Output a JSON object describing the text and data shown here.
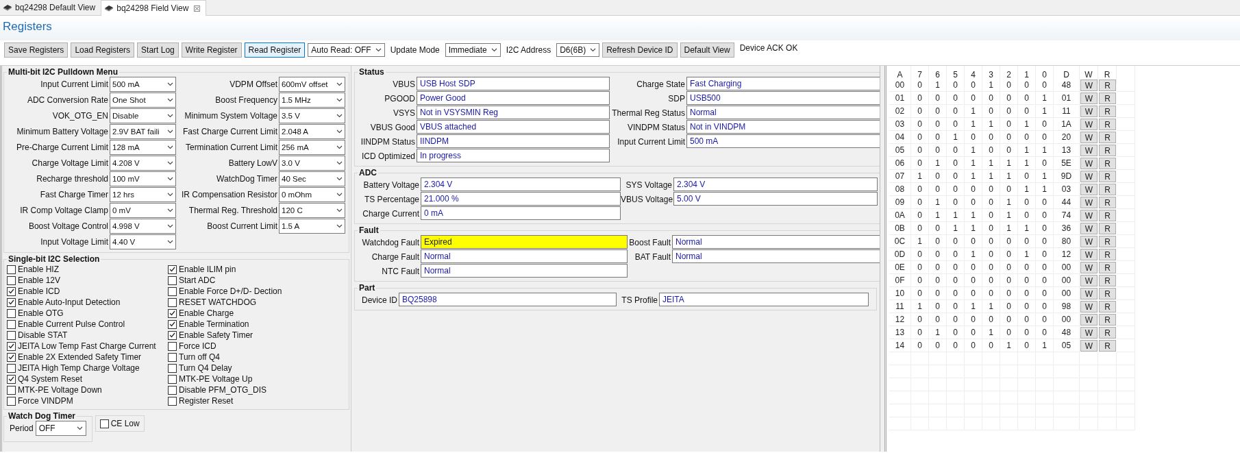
{
  "tabs": [
    {
      "label": "bq24298 Default View",
      "selected": false,
      "closable": false
    },
    {
      "label": "bq24298 Field View",
      "selected": true,
      "closable": true
    }
  ],
  "title": "Registers",
  "toolbar": [
    {
      "kind": "button",
      "label": "Save Registers",
      "focused": false
    },
    {
      "kind": "button",
      "label": "Load Registers",
      "focused": false
    },
    {
      "kind": "button",
      "label": "Start Log",
      "focused": false
    },
    {
      "kind": "button",
      "label": "Write Register",
      "focused": false
    },
    {
      "kind": "button",
      "label": "Read Register",
      "focused": true
    },
    {
      "kind": "dropdown",
      "label": "Auto Read: OFF"
    },
    {
      "kind": "label",
      "label": "Update Mode"
    },
    {
      "kind": "dropdown",
      "label": "Immediate"
    },
    {
      "kind": "label",
      "label": "I2C Address"
    },
    {
      "kind": "dropdown",
      "label": "D6(6B)"
    },
    {
      "kind": "button",
      "label": "Refresh Device ID",
      "focused": false
    },
    {
      "kind": "button",
      "label": "Default View",
      "focused": false
    },
    {
      "kind": "label",
      "label": "Device ACK OK"
    }
  ],
  "multibit": {
    "title": "Multi-bit I2C Pulldown Menu",
    "left": [
      {
        "label": "Input Current Limit",
        "value": "500 mA"
      },
      {
        "label": "ADC Conversion Rate",
        "value": "One Shot"
      },
      {
        "label": "VOK_OTG_EN",
        "value": "Disable"
      },
      {
        "label": "Minimum Battery Voltage",
        "value": "2.9V BAT faili"
      },
      {
        "label": "Pre-Charge Current Limit",
        "value": "128 mA"
      },
      {
        "label": "Charge Voltage Limit",
        "value": "4.208 V"
      },
      {
        "label": "Recharge threshold",
        "value": "100 mV"
      },
      {
        "label": "Fast Charge Timer",
        "value": "12 hrs"
      },
      {
        "label": "IR Comp Voltage Clamp",
        "value": "0 mV"
      },
      {
        "label": "Boost Voltage Control",
        "value": "4.998 V"
      },
      {
        "label": "Input Voltage Limit",
        "value": "4.40 V"
      }
    ],
    "right": [
      {
        "label": "VDPM Offset",
        "value": "600mV offset"
      },
      {
        "label": "Boost Frequency",
        "value": "1.5 MHz"
      },
      {
        "label": "Minimum System Voltage",
        "value": "3.5 V"
      },
      {
        "label": "Fast Charge Current Limit",
        "value": "2.048 A"
      },
      {
        "label": "Termination Current Limit",
        "value": "256 mA"
      },
      {
        "label": "Battery LowV",
        "value": "3.0 V"
      },
      {
        "label": "WatchDog Timer",
        "value": "40 Sec"
      },
      {
        "label": "IR Compensation Resistor",
        "value": "0 mOhm"
      },
      {
        "label": "Thermal Reg. Threshold",
        "value": "120 C"
      },
      {
        "label": "Boost Current Limit",
        "value": "1.5 A"
      }
    ]
  },
  "singlebit": {
    "title": "Single-bit I2C Selection",
    "left": [
      {
        "label": "Enable HIZ",
        "checked": false
      },
      {
        "label": "Enable 12V",
        "checked": false
      },
      {
        "label": "Enable ICD",
        "checked": true
      },
      {
        "label": "Enable Auto-Input Detection",
        "checked": true
      },
      {
        "label": "Enable OTG",
        "checked": false
      },
      {
        "label": "Enable Current Pulse Control",
        "checked": false
      },
      {
        "label": "Disable STAT",
        "checked": false
      },
      {
        "label": "JEITA Low Temp Fast Charge Current",
        "checked": true
      },
      {
        "label": "Enable 2X Extended Safety Timer",
        "checked": true
      },
      {
        "label": "JEITA High Temp Charge Voltage",
        "checked": false
      },
      {
        "label": "Q4 System Reset",
        "checked": true
      },
      {
        "label": "MTK-PE Voltage Down",
        "checked": false
      },
      {
        "label": "Force VINDPM",
        "checked": false
      }
    ],
    "right": [
      {
        "label": "Enable ILIM pin",
        "checked": true
      },
      {
        "label": "Start ADC",
        "checked": false
      },
      {
        "label": "Enable Force D+/D- Dection",
        "checked": false
      },
      {
        "label": "RESET WATCHDOG",
        "checked": false
      },
      {
        "label": "Enable Charge",
        "checked": true
      },
      {
        "label": "Enable Termination",
        "checked": true
      },
      {
        "label": "Enable Safety Timer",
        "checked": true
      },
      {
        "label": "Force ICD",
        "checked": false
      },
      {
        "label": "Turn off Q4",
        "checked": false
      },
      {
        "label": "Turn Q4 Delay",
        "checked": false
      },
      {
        "label": "MTK-PE Voltage Up",
        "checked": false
      },
      {
        "label": "Disable PFM_OTG_DIS",
        "checked": false
      },
      {
        "label": "Register Reset",
        "checked": false
      }
    ]
  },
  "watchdog": {
    "title": "Watch Dog Timer",
    "period_label": "Period",
    "period_value": "OFF"
  },
  "ce_low": {
    "label": "CE Low",
    "checked": false
  },
  "sections": [
    {
      "title": "Status",
      "left": [
        {
          "label": "VBUS",
          "value": "USB Host SDP",
          "alert": false
        },
        {
          "label": "PGOOD",
          "value": "Power Good",
          "alert": false
        },
        {
          "label": "VSYS",
          "value": "Not in VSYSMIN Reg",
          "alert": false
        },
        {
          "label": "VBUS Good",
          "value": "VBUS attached",
          "alert": false
        },
        {
          "label": "IINDPM Status",
          "value": "IINDPM",
          "alert": false
        },
        {
          "label": "ICD Optimized",
          "value": "In progress",
          "alert": false
        }
      ],
      "right": [
        {
          "label": "Charge State",
          "value": "Fast Charging",
          "alert": false
        },
        {
          "label": "SDP",
          "value": "USB500",
          "alert": false
        },
        {
          "label": "Thermal Reg Status",
          "value": "Normal",
          "alert": false
        },
        {
          "label": "VINDPM Status",
          "value": "Not in VINDPM",
          "alert": false
        },
        {
          "label": "Input Current Limit",
          "value": "500 mA",
          "alert": false
        }
      ]
    },
    {
      "title": "ADC",
      "left": [
        {
          "label": "Battery Voltage",
          "value": "2.304 V",
          "alert": false
        },
        {
          "label": "TS Percentage",
          "value": "21.000 %",
          "alert": false
        },
        {
          "label": "Charge Current",
          "value": "0 mA",
          "alert": false
        }
      ],
      "right": [
        {
          "label": "SYS Voltage",
          "value": "2.304 V",
          "alert": false
        },
        {
          "label": "VBUS Voltage",
          "value": "5.00 V",
          "alert": false
        }
      ]
    },
    {
      "title": "Fault",
      "left": [
        {
          "label": "Watchdog Fault",
          "value": "Expired",
          "alert": true
        },
        {
          "label": "Charge Fault",
          "value": "Normal",
          "alert": false
        },
        {
          "label": "NTC Fault",
          "value": "Normal",
          "alert": false
        }
      ],
      "right": [
        {
          "label": "Boost Fault",
          "value": "Normal",
          "alert": false
        },
        {
          "label": "BAT Fault",
          "value": "Normal",
          "alert": false
        }
      ]
    },
    {
      "title": "Part",
      "left": [
        {
          "label": "Device ID",
          "value": "BQ25898",
          "alert": false
        }
      ],
      "right": [
        {
          "label": "TS Profile",
          "value": "JEITA",
          "alert": false
        }
      ]
    }
  ],
  "registers": {
    "columns": [
      "A",
      "7",
      "6",
      "5",
      "4",
      "3",
      "2",
      "1",
      "0",
      "D",
      "W",
      "R"
    ],
    "rows": [
      {
        "address": "00",
        "bits": [
          "0",
          "1",
          "0",
          "0",
          "1",
          "0",
          "0",
          "0"
        ],
        "data": "48",
        "write": "W",
        "read": "R"
      },
      {
        "address": "01",
        "bits": [
          "0",
          "0",
          "0",
          "0",
          "0",
          "0",
          "0",
          "1"
        ],
        "data": "01",
        "write": "W",
        "read": "R"
      },
      {
        "address": "02",
        "bits": [
          "0",
          "0",
          "0",
          "1",
          "0",
          "0",
          "0",
          "1"
        ],
        "data": "11",
        "write": "W",
        "read": "R"
      },
      {
        "address": "03",
        "bits": [
          "0",
          "0",
          "0",
          "1",
          "1",
          "0",
          "1",
          "0"
        ],
        "data": "1A",
        "write": "W",
        "read": "R"
      },
      {
        "address": "04",
        "bits": [
          "0",
          "0",
          "1",
          "0",
          "0",
          "0",
          "0",
          "0"
        ],
        "data": "20",
        "write": "W",
        "read": "R"
      },
      {
        "address": "05",
        "bits": [
          "0",
          "0",
          "0",
          "1",
          "0",
          "0",
          "1",
          "1"
        ],
        "data": "13",
        "write": "W",
        "read": "R"
      },
      {
        "address": "06",
        "bits": [
          "0",
          "1",
          "0",
          "1",
          "1",
          "1",
          "1",
          "0"
        ],
        "data": "5E",
        "write": "W",
        "read": "R"
      },
      {
        "address": "07",
        "bits": [
          "1",
          "0",
          "0",
          "1",
          "1",
          "1",
          "0",
          "1"
        ],
        "data": "9D",
        "write": "W",
        "read": "R"
      },
      {
        "address": "08",
        "bits": [
          "0",
          "0",
          "0",
          "0",
          "0",
          "0",
          "1",
          "1"
        ],
        "data": "03",
        "write": "W",
        "read": "R"
      },
      {
        "address": "09",
        "bits": [
          "0",
          "1",
          "0",
          "0",
          "0",
          "1",
          "0",
          "0"
        ],
        "data": "44",
        "write": "W",
        "read": "R"
      },
      {
        "address": "0A",
        "bits": [
          "0",
          "1",
          "1",
          "1",
          "0",
          "1",
          "0",
          "0"
        ],
        "data": "74",
        "write": "W",
        "read": "R"
      },
      {
        "address": "0B",
        "bits": [
          "0",
          "0",
          "1",
          "1",
          "0",
          "1",
          "1",
          "0"
        ],
        "data": "36",
        "write": "W",
        "read": "R"
      },
      {
        "address": "0C",
        "bits": [
          "1",
          "0",
          "0",
          "0",
          "0",
          "0",
          "0",
          "0"
        ],
        "data": "80",
        "write": "W",
        "read": "R"
      },
      {
        "address": "0D",
        "bits": [
          "0",
          "0",
          "0",
          "1",
          "0",
          "0",
          "1",
          "0"
        ],
        "data": "12",
        "write": "W",
        "read": "R"
      },
      {
        "address": "0E",
        "bits": [
          "0",
          "0",
          "0",
          "0",
          "0",
          "0",
          "0",
          "0"
        ],
        "data": "00",
        "write": "W",
        "read": "R"
      },
      {
        "address": "0F",
        "bits": [
          "0",
          "0",
          "0",
          "0",
          "0",
          "0",
          "0",
          "0"
        ],
        "data": "00",
        "write": "W",
        "read": "R"
      },
      {
        "address": "10",
        "bits": [
          "0",
          "0",
          "0",
          "0",
          "0",
          "0",
          "0",
          "0"
        ],
        "data": "00",
        "write": "W",
        "read": "R"
      },
      {
        "address": "11",
        "bits": [
          "1",
          "0",
          "0",
          "1",
          "1",
          "0",
          "0",
          "0"
        ],
        "data": "98",
        "write": "W",
        "read": "R"
      },
      {
        "address": "12",
        "bits": [
          "0",
          "0",
          "0",
          "0",
          "0",
          "0",
          "0",
          "0"
        ],
        "data": "00",
        "write": "W",
        "read": "R"
      },
      {
        "address": "13",
        "bits": [
          "0",
          "1",
          "0",
          "0",
          "1",
          "0",
          "0",
          "0"
        ],
        "data": "48",
        "write": "W",
        "read": "R"
      },
      {
        "address": "14",
        "bits": [
          "0",
          "0",
          "0",
          "0",
          "0",
          "1",
          "0",
          "1"
        ],
        "data": "05",
        "write": "W",
        "read": "R"
      }
    ]
  }
}
